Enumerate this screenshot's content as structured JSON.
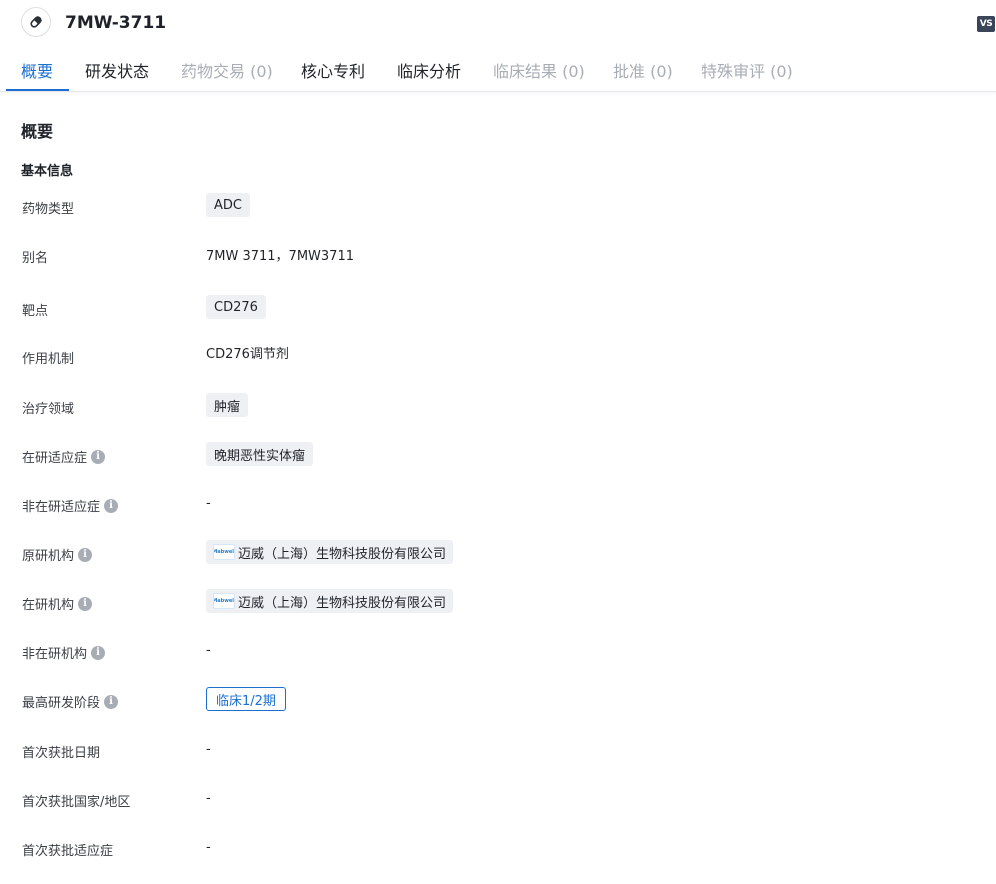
{
  "header": {
    "title": "7MW-3711",
    "drug_icon": "pill-icon",
    "badge": "VS"
  },
  "tabs": [
    {
      "label": "概要",
      "state": "active"
    },
    {
      "label": "研发状态",
      "state": "normal"
    },
    {
      "label": "药物交易 (0)",
      "state": "disabled"
    },
    {
      "label": "核心专利",
      "state": "normal"
    },
    {
      "label": "临床分析",
      "state": "normal"
    },
    {
      "label": "临床结果 (0)",
      "state": "disabled"
    },
    {
      "label": "批准 (0)",
      "state": "disabled"
    },
    {
      "label": "特殊审评 (0)",
      "state": "disabled"
    }
  ],
  "overview": {
    "section_title": "概要",
    "basic_info_title": "基本信息",
    "rows": {
      "drug_type": {
        "label": "药物类型",
        "value": "ADC"
      },
      "alias": {
        "label": "别名",
        "value": "7MW 3711，7MW3711"
      },
      "target": {
        "label": "靶点",
        "value": "CD276"
      },
      "mechanism": {
        "label": "作用机制",
        "value": "CD276调节剂"
      },
      "therapeutic_area": {
        "label": "治疗领域",
        "value": "肿瘤"
      },
      "active_indication": {
        "label": "在研适应症",
        "value": "晚期恶性实体瘤"
      },
      "inactive_indication": {
        "label": "非在研适应症",
        "value": "-"
      },
      "originator": {
        "label": "原研机构",
        "value": "迈威（上海）生物科技股份有限公司",
        "logo_text": "Mabwell"
      },
      "active_org": {
        "label": "在研机构",
        "value": "迈威（上海）生物科技股份有限公司",
        "logo_text": "Mabwell"
      },
      "inactive_org": {
        "label": "非在研机构",
        "value": "-"
      },
      "highest_phase": {
        "label": "最高研发阶段",
        "value": "临床1/2期"
      },
      "first_approval_date": {
        "label": "首次获批日期",
        "value": "-"
      },
      "first_approval_country": {
        "label": "首次获批国家/地区",
        "value": "-"
      },
      "first_approval_indication": {
        "label": "首次获批适应症",
        "value": "-"
      }
    }
  },
  "colors": {
    "accent": "#1a6fd1",
    "disabled_text": "#a8adb5",
    "tag_bg": "#eef0f3",
    "badge_bg": "#3a4559"
  }
}
